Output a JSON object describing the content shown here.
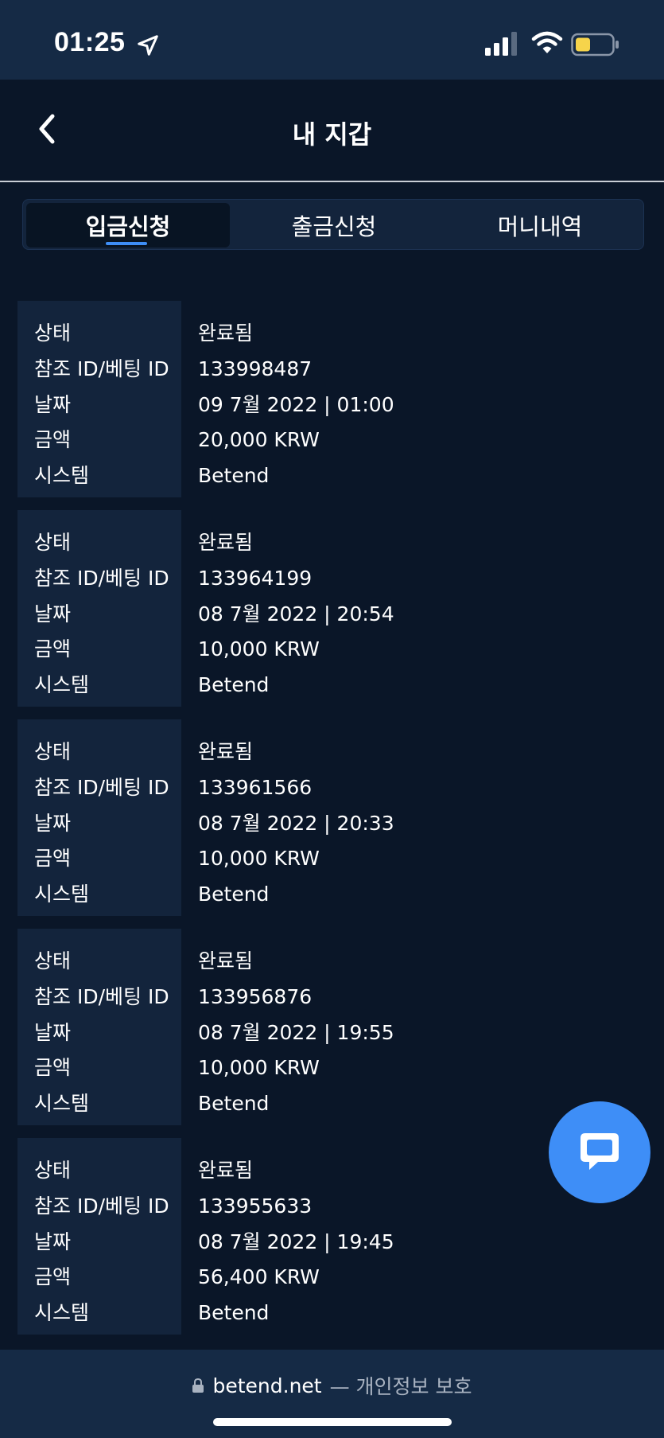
{
  "status_bar": {
    "time": "01:25",
    "battery_color": "#f6d44b"
  },
  "header": {
    "title": "내 지갑"
  },
  "tabs": [
    {
      "label": "입금신청",
      "active": true
    },
    {
      "label": "출금신청",
      "active": false
    },
    {
      "label": "머니내역",
      "active": false
    }
  ],
  "field_labels": {
    "status": "상태",
    "reference": "참조 ID/베팅 ID",
    "date": "날짜",
    "amount": "금액",
    "system": "시스템"
  },
  "records": [
    {
      "status": "완료됨",
      "reference": "133998487",
      "date": "09 7월 2022 | 01:00",
      "amount": "20,000 KRW",
      "system": "Betend"
    },
    {
      "status": "완료됨",
      "reference": "133964199",
      "date": "08 7월 2022 | 20:54",
      "amount": "10,000 KRW",
      "system": "Betend"
    },
    {
      "status": "완료됨",
      "reference": "133961566",
      "date": "08 7월 2022 | 20:33",
      "amount": "10,000 KRW",
      "system": "Betend"
    },
    {
      "status": "완료됨",
      "reference": "133956876",
      "date": "08 7월 2022 | 19:55",
      "amount": "10,000 KRW",
      "system": "Betend"
    },
    {
      "status": "완료됨",
      "reference": "133955633",
      "date": "08 7월 2022 | 19:45",
      "amount": "56,400 KRW",
      "system": "Betend"
    }
  ],
  "colors": {
    "accent": "#3e8ef7",
    "background": "#0a1628",
    "panel": "#13243c"
  },
  "browser": {
    "domain": "betend.net",
    "suffix": "— 개인정보 보호"
  },
  "icons": {
    "back": "chevron-left-icon",
    "chat": "chat-bubble-icon",
    "lock": "lock-icon"
  }
}
